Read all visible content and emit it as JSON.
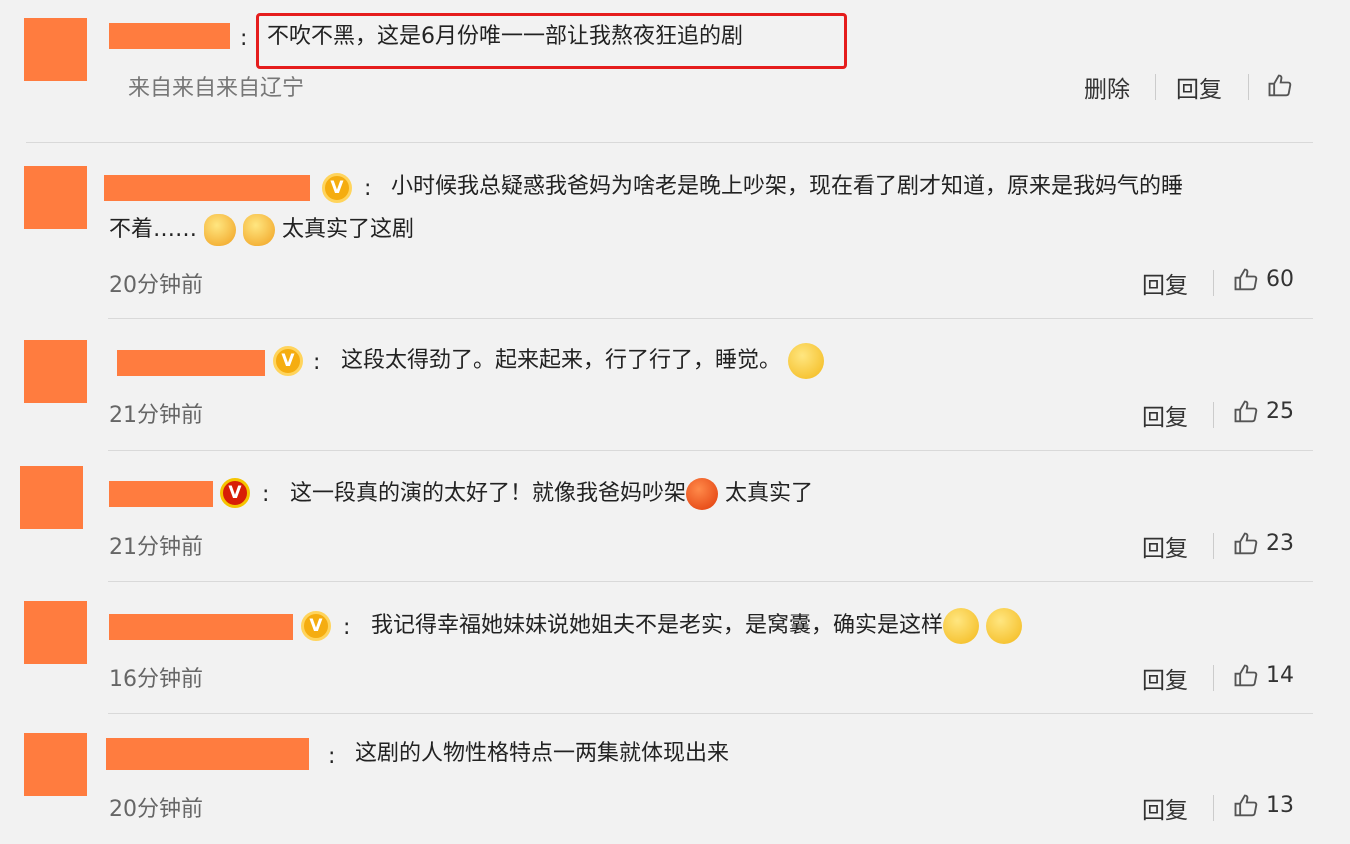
{
  "comments": [
    {
      "text": "不吹不黑，这是6月份唯一一部让我熬夜狂追的剧",
      "location": "来自来自来自辽宁",
      "delete_label": "删除",
      "reply_label": "回复"
    },
    {
      "text_line1": "小时候我总疑惑我爸妈为啥老是晚上吵架，现在看了剧才知道，原来是我妈气的睡",
      "text_line2_a": "不着……",
      "text_line2_b": "太真实了这剧",
      "time": "20分钟前",
      "reply_label": "回复",
      "likes": "60"
    },
    {
      "text": "这段太得劲了。起来起来，行了行了，睡觉。",
      "time": "21分钟前",
      "reply_label": "回复",
      "likes": "25"
    },
    {
      "text_a": "这一段真的演的太好了！就像我爸妈吵架",
      "text_b": "太真实了",
      "time": "21分钟前",
      "reply_label": "回复",
      "likes": "23"
    },
    {
      "text": "我记得幸福她妹妹说她姐夫不是老实，是窝囊，确实是这样",
      "time": "16分钟前",
      "reply_label": "回复",
      "likes": "14"
    },
    {
      "text": "这剧的人物性格特点一两集就体现出来",
      "time": "20分钟前",
      "reply_label": "回复",
      "likes": "13"
    }
  ],
  "verified_mark": "V",
  "colors": {
    "redaction": "#ff7c3f",
    "highlight": "#e51d1d",
    "badge": "#f5ad10"
  }
}
